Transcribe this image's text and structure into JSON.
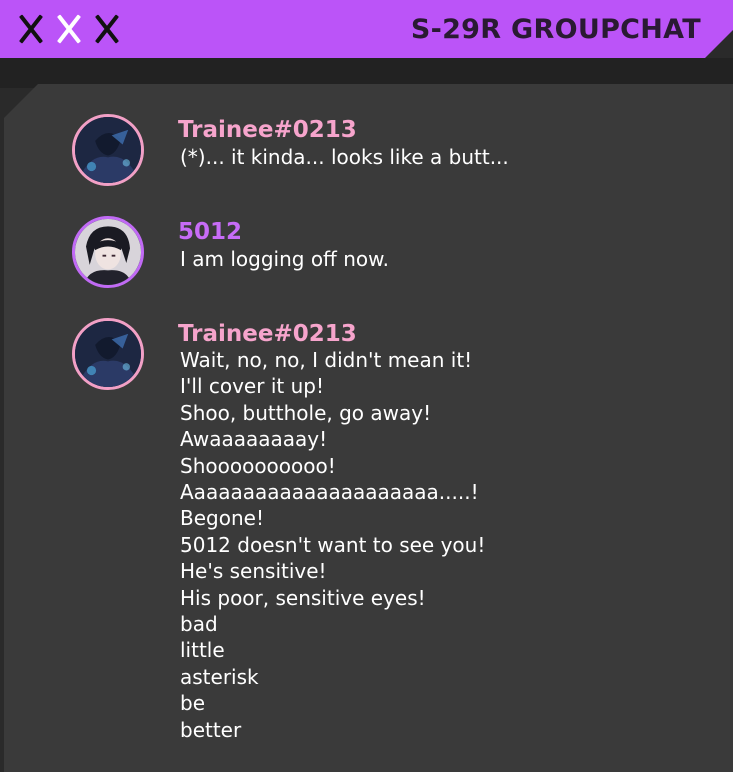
{
  "window": {
    "title": "S-29R GROUPCHAT"
  },
  "controls": [
    "close-icon",
    "close-icon",
    "close-icon"
  ],
  "colors": {
    "titlebar": "#bb54f8",
    "panel": "#3a3a3a",
    "trainee_name": "#f6a4cc",
    "user_5012_name": "#c76cf7"
  },
  "messages": [
    {
      "author": "Trainee#0213",
      "lines": [
        "(*)... it kinda... looks like a butt..."
      ]
    },
    {
      "author": "5012",
      "lines": [
        "I am logging off now."
      ]
    },
    {
      "author": "Trainee#0213",
      "lines": [
        "Wait, no, no, I didn't mean it!",
        "I'll cover it up!",
        "Shoo, butthole, go away!",
        "Awaaaaaaaay!",
        "Shoooooooooo!",
        "Aaaaaaaaaaaaaaaaaaaaa.....!",
        "Begone!",
        "5012 doesn't want to see you!",
        "He's sensitive!",
        "His poor, sensitive eyes!",
        "bad",
        "little",
        "asterisk",
        "be",
        "better"
      ]
    }
  ]
}
